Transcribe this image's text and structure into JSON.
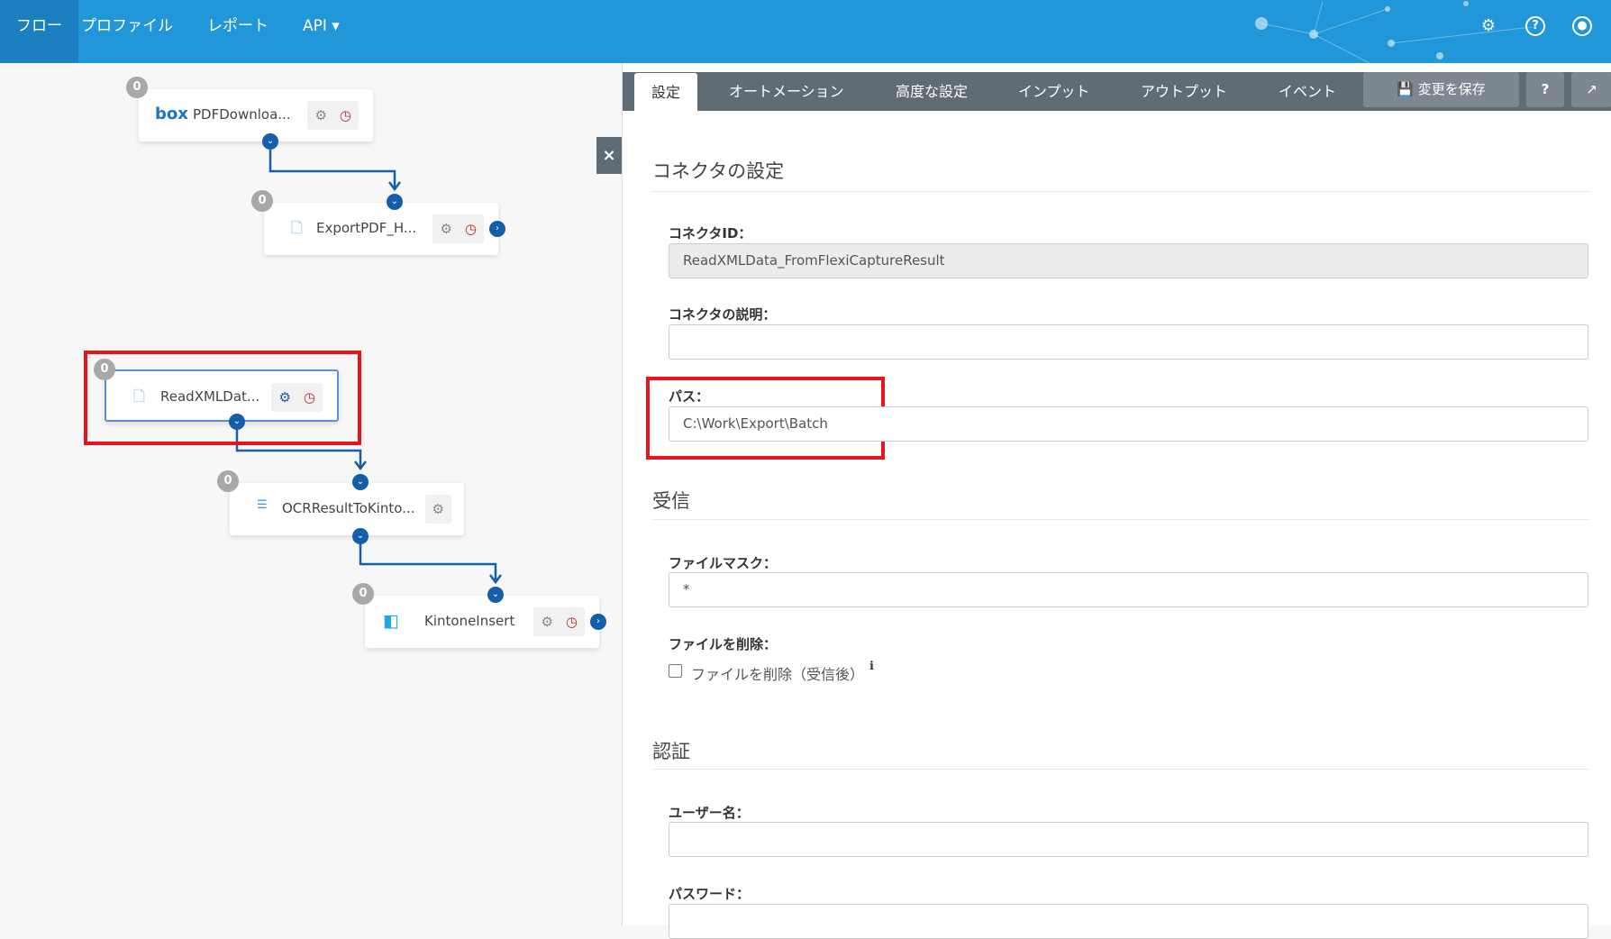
{
  "topnav": {
    "items": [
      "フロー",
      "プロファイル",
      "レポート",
      "API ▾"
    ],
    "icons": [
      "gear-icon",
      "help-icon",
      "user-icon"
    ]
  },
  "flow": {
    "nodes": [
      {
        "name": "PDFDownloa...",
        "icon": "box",
        "count": "0"
      },
      {
        "name": "ExportPDF_H...",
        "icon": "file",
        "count": "0"
      },
      {
        "name": "ReadXMLDat...",
        "icon": "file",
        "count": "0"
      },
      {
        "name": "OCRResultToKinto...",
        "icon": "xml-map",
        "count": "0"
      },
      {
        "name": "KintoneInsert",
        "icon": "kintone",
        "count": "0"
      }
    ],
    "close": "×"
  },
  "panel": {
    "tabs": [
      "設定",
      "オートメーション",
      "高度な設定",
      "インプット",
      "アウトプット",
      "イベント"
    ],
    "save": "💾 変更を保存",
    "help": "?",
    "popout": "↗",
    "section_title": "コネクタの設定",
    "id_label": "コネクタID：",
    "id_value": "ReadXMLData_FromFlexiCaptureResult",
    "desc_label": "コネクタの説明：",
    "path_label": "パス：",
    "path_value": "C:\\Work\\Export\\Batch",
    "receive_title": "受信",
    "mask_label": "ファイルマスク：",
    "mask_value": "*",
    "delete_label": "ファイルを削除：",
    "delete_check": "ファイルを削除（受信後）",
    "info": "ℹ",
    "auth_title": "認証",
    "user_label": "ユーザー名：",
    "pass_label": "パスワード："
  }
}
